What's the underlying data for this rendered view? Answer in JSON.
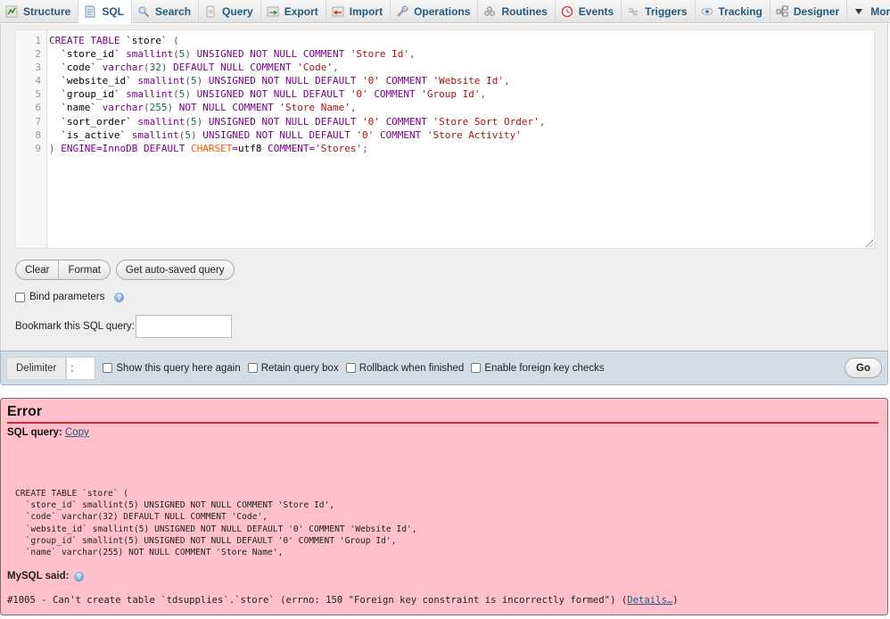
{
  "tabs": [
    {
      "label": "Structure",
      "icon": "structure-icon",
      "active": false
    },
    {
      "label": "SQL",
      "icon": "sql-icon",
      "active": true
    },
    {
      "label": "Search",
      "icon": "search-icon",
      "active": false
    },
    {
      "label": "Query",
      "icon": "query-icon",
      "active": false
    },
    {
      "label": "Export",
      "icon": "export-icon",
      "active": false
    },
    {
      "label": "Import",
      "icon": "import-icon",
      "active": false
    },
    {
      "label": "Operations",
      "icon": "wrench-icon",
      "active": false
    },
    {
      "label": "Routines",
      "icon": "routines-icon",
      "active": false
    },
    {
      "label": "Events",
      "icon": "clock-icon",
      "active": false
    },
    {
      "label": "Triggers",
      "icon": "triggers-icon",
      "active": false
    },
    {
      "label": "Tracking",
      "icon": "eye-icon",
      "active": false
    },
    {
      "label": "Designer",
      "icon": "designer-icon",
      "active": false
    },
    {
      "label": "More",
      "icon": "caret-down-icon",
      "active": false
    }
  ],
  "editor": {
    "line_numbers": [
      "1",
      "2",
      "3",
      "4",
      "5",
      "6",
      "7",
      "8",
      "9"
    ],
    "lines": [
      "CREATE TABLE `store` (",
      "  `store_id` smallint(5) UNSIGNED NOT NULL COMMENT 'Store Id',",
      "  `code` varchar(32) DEFAULT NULL COMMENT 'Code',",
      "  `website_id` smallint(5) UNSIGNED NOT NULL DEFAULT '0' COMMENT 'Website Id',",
      "  `group_id` smallint(5) UNSIGNED NOT NULL DEFAULT '0' COMMENT 'Group Id',",
      "  `name` varchar(255) NOT NULL COMMENT 'Store Name',",
      "  `sort_order` smallint(5) UNSIGNED NOT NULL DEFAULT '0' COMMENT 'Store Sort Order',",
      "  `is_active` smallint(5) UNSIGNED NOT NULL DEFAULT '0' COMMENT 'Store Activity'",
      ") ENGINE=InnoDB DEFAULT CHARSET=utf8 COMMENT='Stores';"
    ]
  },
  "buttons": {
    "clear": "Clear",
    "format": "Format",
    "autosaved": "Get auto-saved query",
    "go": "Go"
  },
  "bind_parameters": {
    "label": "Bind parameters",
    "checked": false
  },
  "bookmark": {
    "label": "Bookmark this SQL query:",
    "value": ""
  },
  "toolbar": {
    "delimiter_label": "Delimiter",
    "delimiter_value": ";",
    "options": [
      {
        "label": "Show this query here again",
        "checked": false
      },
      {
        "label": "Retain query box",
        "checked": false
      },
      {
        "label": "Rollback when finished",
        "checked": false
      },
      {
        "label": "Enable foreign key checks",
        "checked": false
      }
    ]
  },
  "error": {
    "title": "Error",
    "sql_query_label": "SQL query:",
    "copy_link": "Copy",
    "query_lines": [
      "CREATE TABLE `store` (",
      "  `store_id` smallint(5) UNSIGNED NOT NULL COMMENT 'Store Id',",
      "  `code` varchar(32) DEFAULT NULL COMMENT 'Code',",
      "  `website_id` smallint(5) UNSIGNED NOT NULL DEFAULT '0' COMMENT 'Website Id',",
      "  `group_id` smallint(5) UNSIGNED NOT NULL DEFAULT '0' COMMENT 'Group Id',",
      "  `name` varchar(255) NOT NULL COMMENT 'Store Name',"
    ],
    "mysql_said_label": "MySQL said:",
    "message": "#1005 - Can't create table `tdsupplies`.`store` (errno: 150 \"Foreign key constraint is incorrectly formed\") (",
    "details_link": "Details…",
    "message_end": ")"
  },
  "colors": {
    "tab_text": "#235a81",
    "error_bg": "#ffc0cb",
    "error_rule": "#e0232f",
    "keyword": "#770088",
    "string": "#aa1111",
    "number": "#116644",
    "charset": "#ff5500"
  }
}
